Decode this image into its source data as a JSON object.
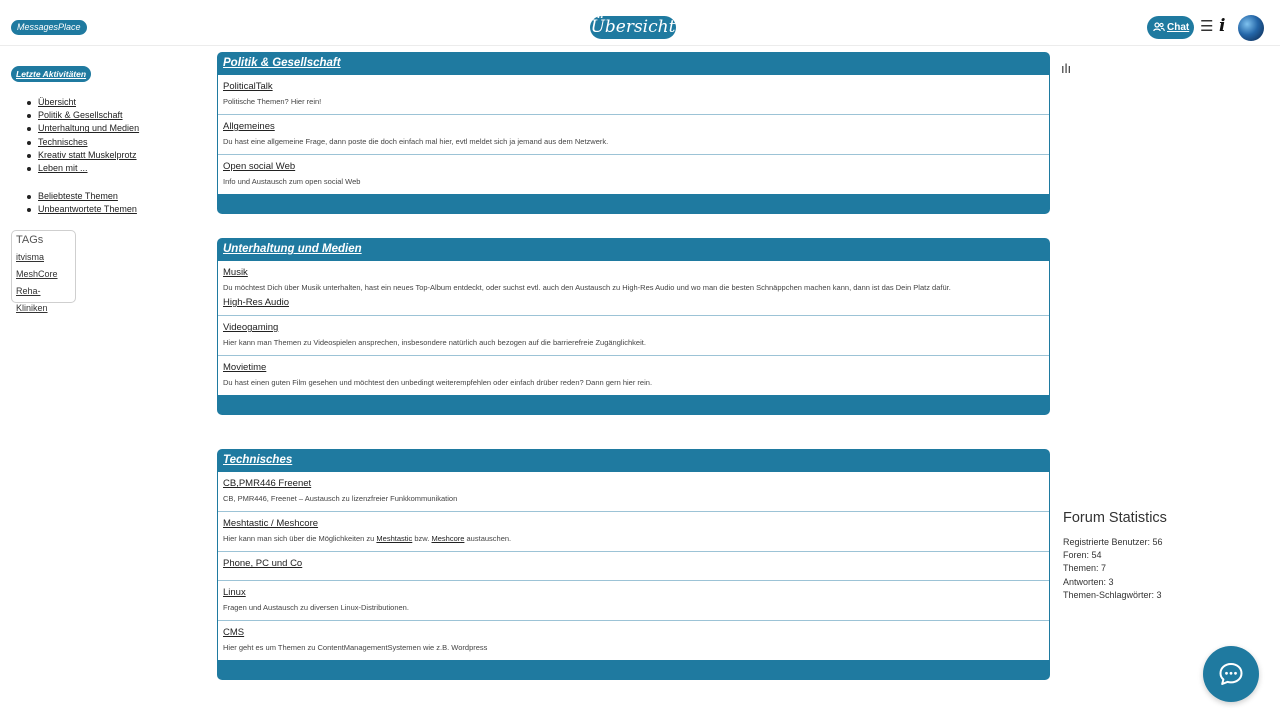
{
  "header": {
    "brand": "MessagesPlace",
    "page_title": "Übersicht",
    "chat_label": "Chat",
    "menu_icon": "hamburger-icon",
    "info_icon": "info-icon"
  },
  "sidebar": {
    "recent_activity": "Letzte Aktivitäten",
    "nav": [
      "Übersicht",
      "Politik & Gesellschaft",
      "Unterhaltung und Medien",
      "Technisches",
      "Kreativ statt Muskelprotz",
      "Leben mit ..."
    ],
    "nav2": [
      "Beliebteste Themen",
      "Unbeantwortete Themen"
    ],
    "tags_title": "TAGs",
    "tags": [
      "itvisma",
      "MeshCore",
      "Reha-Kliniken"
    ]
  },
  "categories": [
    {
      "title": "Politik & Gesellschaft",
      "forums": [
        {
          "title": "PoliticalTalk",
          "desc": "Politische Themen? Hier rein!"
        },
        {
          "title": "Allgemeines",
          "desc": "Du hast eine allgemeine Frage, dann poste die doch einfach mal hier, evtl meldet sich ja jemand aus dem Netzwerk."
        },
        {
          "title": "Open social Web",
          "desc": "Info und Austausch zum open social Web"
        }
      ]
    },
    {
      "title": "Unterhaltung und Medien",
      "forums": [
        {
          "title": "Musik",
          "desc": "Du möchtest Dich über Musik unterhalten, hast ein neues Top-Album entdeckt, oder suchst evtl. auch den Austausch zu High-Res Audio und wo man die besten Schnäppchen machen kann, dann ist das Dein Platz dafür.",
          "sub": "High-Res Audio"
        },
        {
          "title": "Videogaming",
          "desc": "Hier kann man Themen zu Videospielen ansprechen, insbesondere natürlich auch bezogen auf die barrierefreie Zugänglichkeit."
        },
        {
          "title": "Movietime",
          "desc": "Du hast einen guten Film gesehen und möchtest den unbedingt weiterempfehlen oder einfach drüber reden? Dann gern hier rein."
        }
      ]
    },
    {
      "title": "Technisches",
      "forums": [
        {
          "title": "CB,PMR446 Freenet",
          "desc": "CB, PMR446, Freenet – Austausch zu lizenzfreier Funkkommunikation"
        },
        {
          "title": "Meshtastic / Meshcore",
          "desc_pre": "Hier kann man sich über die Möglichkeiten zu",
          "desc_link1": "Meshtastic",
          "desc_mid": "bzw.",
          "desc_link2": "Meshcore",
          "desc_post": "austauschen."
        },
        {
          "title": "Phone, PC und Co"
        },
        {
          "title": "Linux",
          "desc": "Fragen und Austausch zu diversen Linux-Distributionen."
        },
        {
          "title": "CMS",
          "desc": "Hier geht es um Themen zu ContentManagementSystemen wie z.B. Wordpress"
        }
      ]
    }
  ],
  "stats": {
    "title": "Forum Statistics",
    "rows": [
      "Registrierte Benutzer: 56",
      "Foren: 54",
      "Themen: 7",
      "Antworten: 3",
      "Themen-Schlagwörter: 3"
    ]
  },
  "colors": {
    "accent": "#1f7aa0"
  }
}
